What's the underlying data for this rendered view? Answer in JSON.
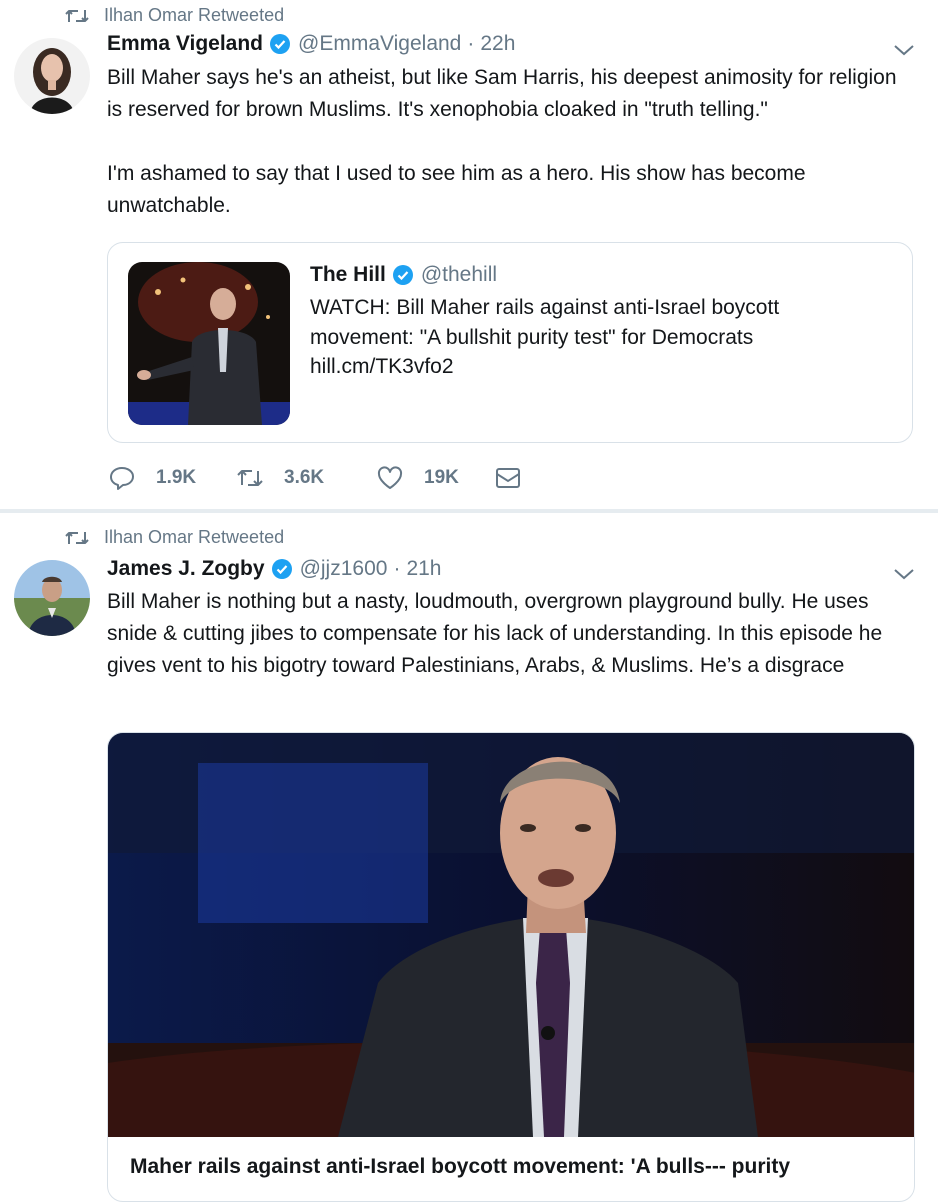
{
  "tweets": [
    {
      "retweeted_by": "Ilhan Omar Retweeted",
      "name": "Emma Vigeland",
      "handle": "@EmmaVigeland",
      "time": "22h",
      "text": [
        "Bill Maher says he's an atheist, but like Sam Harris, his deepest animosity for religion is reserved for brown Muslims. It's xenophobia cloaked in \"truth telling.\"",
        "I'm ashamed to say that I used to see him as a hero. His show has become unwatchable."
      ],
      "quote": {
        "name": "The Hill",
        "handle": "@thehill",
        "text": "WATCH: Bill Maher rails against anti-Israel boycott movement: \"A bullshit purity test\" for Democrats",
        "link": "hill.cm/TK3vfo2"
      },
      "actions": {
        "replies": "1.9K",
        "retweets": "3.6K",
        "likes": "19K"
      }
    },
    {
      "retweeted_by": "Ilhan Omar Retweeted",
      "name": "James J. Zogby",
      "handle": "@jjz1600",
      "time": "21h",
      "text": [
        "Bill Maher is nothing but a nasty, loudmouth, overgrown playground bully. He uses snide & cutting jibes to compensate for his lack of understanding. In this episode he gives vent to his bigotry toward Palestinians, Arabs, & Muslims. He’s a disgrace"
      ],
      "card_title": "Maher rails against anti-Israel boycott movement: 'A bulls--- purity"
    }
  ],
  "colors": {
    "verified": "#1da1f2",
    "muted": "#657786",
    "border": "#d9e1e8"
  },
  "icons": [
    "retweet-icon",
    "verified-badge-icon",
    "chevron-down-icon",
    "reply-icon",
    "heart-icon",
    "mail-icon"
  ]
}
